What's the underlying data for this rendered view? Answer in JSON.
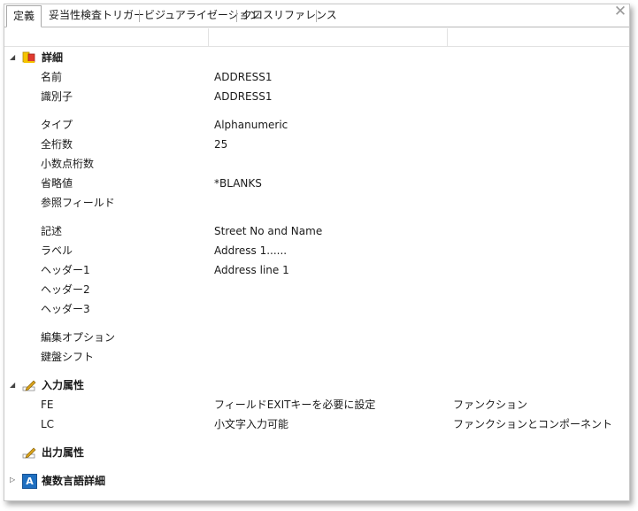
{
  "tabs": [
    {
      "label": "定義"
    },
    {
      "label": "妥当性検査トリガー"
    },
    {
      "label": "ビジュアライゼーション"
    },
    {
      "label": "クロスリファレンス"
    }
  ],
  "close_label": "✕",
  "sections": {
    "details": {
      "title": "詳細",
      "rows": {
        "name": {
          "label": "名前",
          "value": "ADDRESS1"
        },
        "identifier": {
          "label": "識別子",
          "value": "ADDRESS1"
        },
        "type": {
          "label": "タイプ",
          "value": "Alphanumeric"
        },
        "total_digits": {
          "label": "全桁数",
          "value": "25"
        },
        "decimals": {
          "label": "小数点桁数",
          "value": ""
        },
        "default": {
          "label": "省略値",
          "value": "*BLANKS"
        },
        "ref_field": {
          "label": "参照フィールド",
          "value": ""
        },
        "description": {
          "label": "記述",
          "value": "Street No and Name"
        },
        "label_row": {
          "label": "ラベル",
          "value": "Address 1......"
        },
        "header1": {
          "label": "ヘッダー1",
          "value": "Address line 1"
        },
        "header2": {
          "label": "ヘッダー2",
          "value": ""
        },
        "header3": {
          "label": "ヘッダー3",
          "value": ""
        },
        "edit_options": {
          "label": "編集オプション",
          "value": ""
        },
        "keyboard_shift": {
          "label": "鍵盤シフト",
          "value": ""
        }
      }
    },
    "input_attrs": {
      "title": "入力属性",
      "rows": [
        {
          "code": "FE",
          "desc": "フィールドEXITキーを必要に設定",
          "scope": "ファンクション"
        },
        {
          "code": "LC",
          "desc": "小文字入力可能",
          "scope": "ファンクションとコンポーネント"
        }
      ]
    },
    "output_attrs": {
      "title": "出力属性"
    },
    "multilingual": {
      "title": "複数言語詳細",
      "icon_letter": "A"
    }
  },
  "colors": {
    "icon_blue": "#1f6fc0",
    "icon_yellow": "#f5c400",
    "icon_red": "#e03a2f",
    "pencil_gold": "#d9a21a"
  }
}
